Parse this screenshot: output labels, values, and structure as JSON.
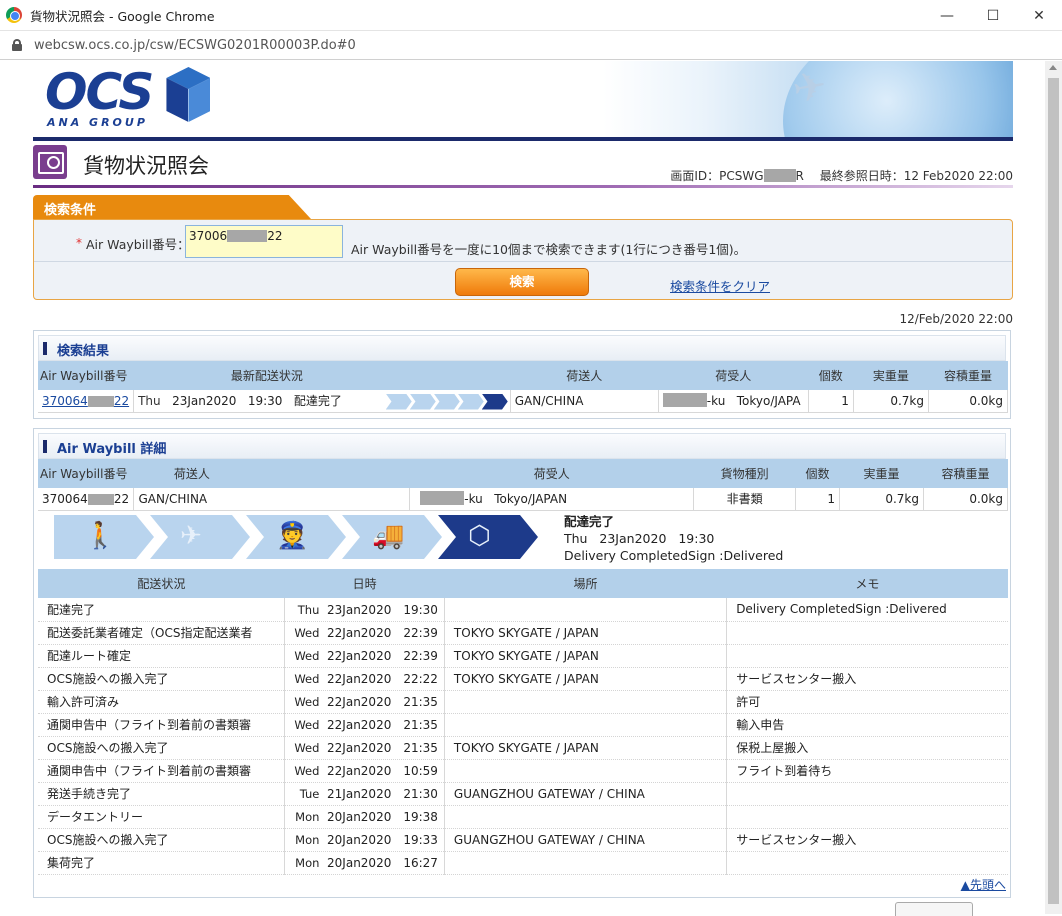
{
  "window": {
    "title": "貨物状況照会 - Google Chrome",
    "url": "webcsw.ocs.co.jp/csw/ECSWG0201R00003P.do#0",
    "controls": [
      "—",
      "☐",
      "✕"
    ]
  },
  "brand": {
    "logo": "OCS",
    "sub": "ANA GROUP"
  },
  "page": {
    "title": "貨物状況照会",
    "screen_id_label": "画面ID：PCSWG",
    "screen_id_suffix": "R",
    "last_ref_label": "最終参照日時：12 Feb2020 22:00"
  },
  "search": {
    "tab_label": "検索条件",
    "required_mark": "*",
    "awb_label": "Air Waybill番号：",
    "awb_prefix": "37006",
    "awb_suffix": "22",
    "hint": "Air Waybill番号を一度に10個まで検索できます(1行につき番号1個)。",
    "search_button": "検索",
    "clear_link": "検索条件をクリア"
  },
  "result_date": "12/Feb/2020 22:00",
  "results": {
    "title": "検索結果",
    "headers": [
      "Air Waybill番号",
      "最新配送状況",
      "荷送人",
      "荷受人",
      "個数",
      "実重量",
      "容積重量"
    ],
    "row": {
      "awb_prefix": "370064",
      "awb_suffix": "22",
      "day": "Thu",
      "date": "23Jan2020",
      "time": "19:30",
      "status": "配達完了",
      "shipper": "GAN/CHINA",
      "consignee_suffix": "-ku",
      "consignee_city": "Tokyo/JAPA",
      "pieces": "1",
      "weight": "0.7kg",
      "volume_weight": "0.0kg"
    }
  },
  "detail": {
    "title": "Air Waybill 詳細",
    "headers": [
      "Air Waybill番号",
      "荷送人",
      "荷受人",
      "貨物種別",
      "個数",
      "実重量",
      "容積重量"
    ],
    "row": {
      "awb_prefix": "370064",
      "awb_suffix": "22",
      "shipper": "GAN/CHINA",
      "consignee_suffix": "-ku",
      "consignee_city": "Tokyo/JAPAN",
      "cargo_type": "非書類",
      "pieces": "1",
      "weight": "0.7kg",
      "volume_weight": "0.0kg"
    },
    "status": {
      "label": "配達完了",
      "day": "Thu",
      "date": "23Jan2020",
      "time": "19:30",
      "note": "Delivery CompletedSign :Delivered"
    },
    "steps": [
      {
        "icon": "walking-person-icon",
        "glyph": "🚶",
        "state": "done"
      },
      {
        "icon": "airplane-icon",
        "glyph": "✈",
        "state": "done"
      },
      {
        "icon": "customs-officer-icon",
        "glyph": "👮",
        "state": "done"
      },
      {
        "icon": "delivery-truck-icon",
        "glyph": "🚚",
        "state": "done"
      },
      {
        "icon": "package-box-icon",
        "glyph": "⬡",
        "state": "current"
      }
    ],
    "history_headers": [
      "配送状況",
      "日時",
      "場所",
      "メモ"
    ],
    "history": [
      {
        "status": "配達完了",
        "day": "Thu",
        "datetime": "23Jan2020　19:30",
        "place": "",
        "memo": "Delivery CompletedSign :Delivered"
      },
      {
        "status": "配送委託業者確定（OCS指定配送業者",
        "day": "Wed",
        "datetime": "22Jan2020　22:39",
        "place": "TOKYO SKYGATE / JAPAN",
        "memo": ""
      },
      {
        "status": "配達ルート確定",
        "day": "Wed",
        "datetime": "22Jan2020　22:39",
        "place": "TOKYO SKYGATE / JAPAN",
        "memo": ""
      },
      {
        "status": "OCS施設への搬入完了",
        "day": "Wed",
        "datetime": "22Jan2020　22:22",
        "place": "TOKYO SKYGATE / JAPAN",
        "memo": "サービスセンター搬入"
      },
      {
        "status": "輸入許可済み",
        "day": "Wed",
        "datetime": "22Jan2020　21:35",
        "place": "",
        "memo": "許可"
      },
      {
        "status": "通関申告中（フライト到着前の書類審",
        "day": "Wed",
        "datetime": "22Jan2020　21:35",
        "place": "",
        "memo": "輸入申告"
      },
      {
        "status": "OCS施設への搬入完了",
        "day": "Wed",
        "datetime": "22Jan2020　21:35",
        "place": "TOKYO SKYGATE / JAPAN",
        "memo": "保税上屋搬入"
      },
      {
        "status": "通関申告中（フライト到着前の書類審",
        "day": "Wed",
        "datetime": "22Jan2020　10:59",
        "place": "",
        "memo": "フライト到着待ち"
      },
      {
        "status": "発送手続き完了",
        "day": "Tue",
        "datetime": "21Jan2020　21:30",
        "place": "GUANGZHOU GATEWAY / CHINA",
        "memo": ""
      },
      {
        "status": "データエントリー",
        "day": "Mon",
        "datetime": "20Jan2020　19:38",
        "place": "",
        "memo": ""
      },
      {
        "status": "OCS施設への搬入完了",
        "day": "Mon",
        "datetime": "20Jan2020　19:33",
        "place": "GUANGZHOU GATEWAY / CHINA",
        "memo": "サービスセンター搬入"
      },
      {
        "status": "集荷完了",
        "day": "Mon",
        "datetime": "20Jan2020　16:27",
        "place": "",
        "memo": ""
      }
    ],
    "to_top": "▲先頭へ"
  }
}
